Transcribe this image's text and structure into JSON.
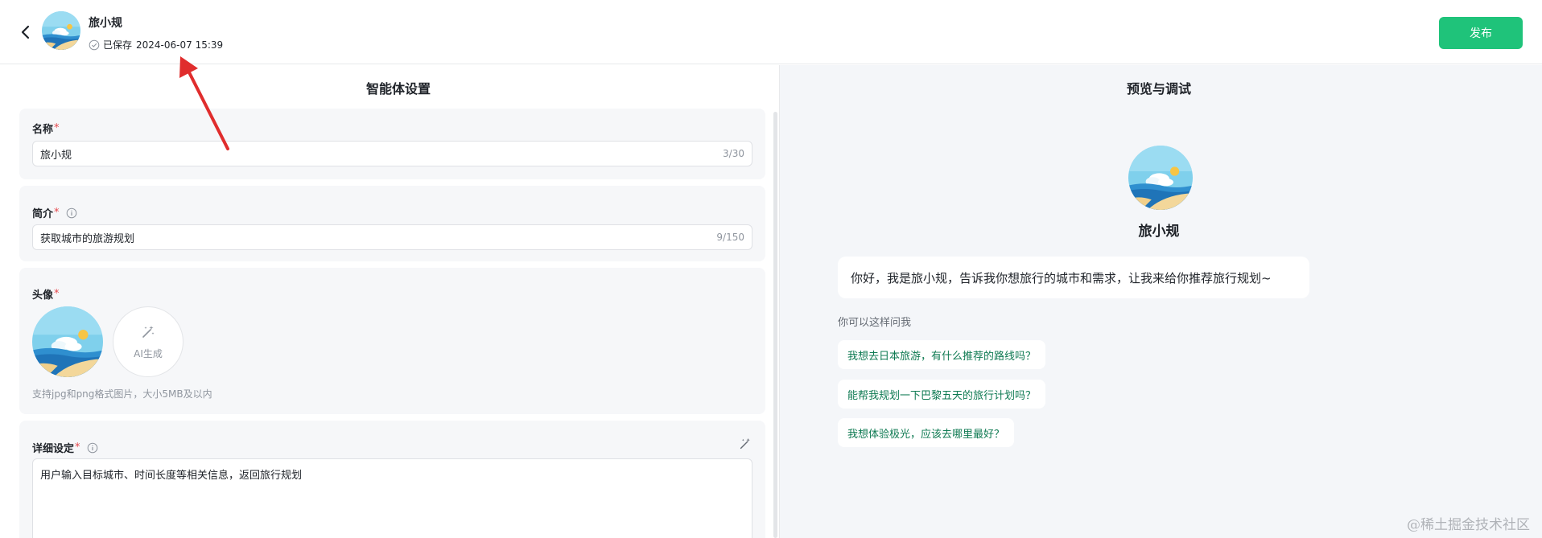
{
  "header": {
    "agent_name": "旅小规",
    "saved_label": "已保存",
    "saved_time": "2024-06-07 15:39",
    "publish_label": "发布"
  },
  "settings": {
    "title": "智能体设置",
    "name": {
      "label": "名称",
      "required_mark": "*",
      "value": "旅小规",
      "counter": "3/30"
    },
    "intro": {
      "label": "简介",
      "required_mark": "*",
      "value": "获取城市的旅游规划",
      "counter": "9/150"
    },
    "avatar": {
      "label": "头像",
      "required_mark": "*",
      "ai_label": "AI生成",
      "hint": "支持jpg和png格式图片，大小5MB及以内"
    },
    "detail": {
      "label": "详细设定",
      "required_mark": "*",
      "value": "用户输入目标城市、时间长度等相关信息，返回旅行规划"
    }
  },
  "preview": {
    "title": "预览与调试",
    "bot_name": "旅小规",
    "greeting": "你好，我是旅小规，告诉我你想旅行的城市和需求，让我来给你推荐旅行规划~",
    "suggest_title": "你可以这样问我",
    "suggestions": [
      "我想去日本旅游，有什么推荐的路线吗？",
      "能帮我规划一下巴黎五天的旅行计划吗？",
      "我想体验极光，应该去哪里最好？"
    ]
  },
  "watermark": "@稀土掘金技术社区",
  "colors": {
    "primary": "#1fc37a",
    "suggest_text": "#0e7a52",
    "required": "#e5484d",
    "annotation_arrow": "#e02d2d"
  }
}
